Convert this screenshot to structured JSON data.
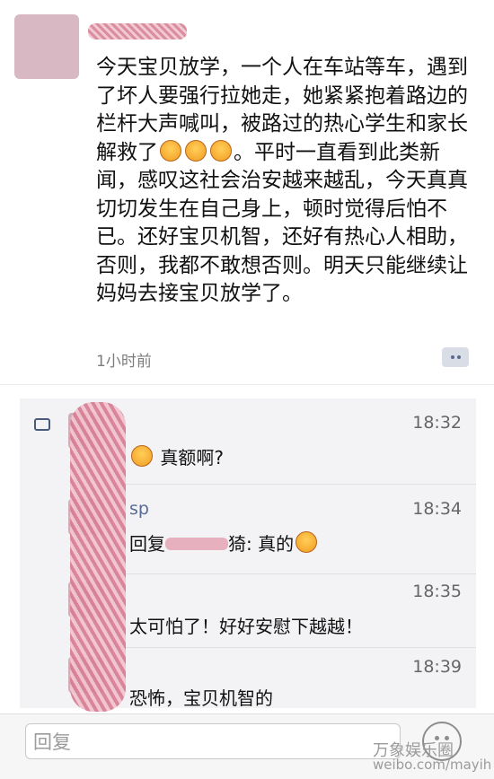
{
  "post": {
    "text": "今天宝贝放学，一个人在车站等车，遇到了坏人要强行拉她走，她紧紧抱着路边的栏杆大声喊叫，被路过的热心学生和家长解救了",
    "text_after_emoji": "。平时一直看到此类新闻，感叹这社会治安越来越乱，今天真真切切发生在自己身上，顿时觉得后怕不已。还好宝贝机智，还好有热心人相助，否则，我都不敢想否则。明天只能继续让妈妈去接宝贝放学了。",
    "time_ago": "1小时前"
  },
  "comments": [
    {
      "time": "18:32",
      "text": "真额啊?"
    },
    {
      "time": "18:34",
      "nick": "sp",
      "text": "回复",
      "text_tail": "猗: 真的"
    },
    {
      "time": "18:35",
      "text": "太可怕了！好好安慰下越越！"
    },
    {
      "time": "18:39",
      "text": "恐怖，宝贝机智的"
    }
  ],
  "reply": {
    "placeholder": "回复"
  },
  "watermark": {
    "name": "万象娱乐圈",
    "url": "weibo.com/mayih"
  },
  "icons": [
    "comment-icon",
    "more-comment-icon",
    "emoji-icon",
    "wechat-logo-icon"
  ]
}
